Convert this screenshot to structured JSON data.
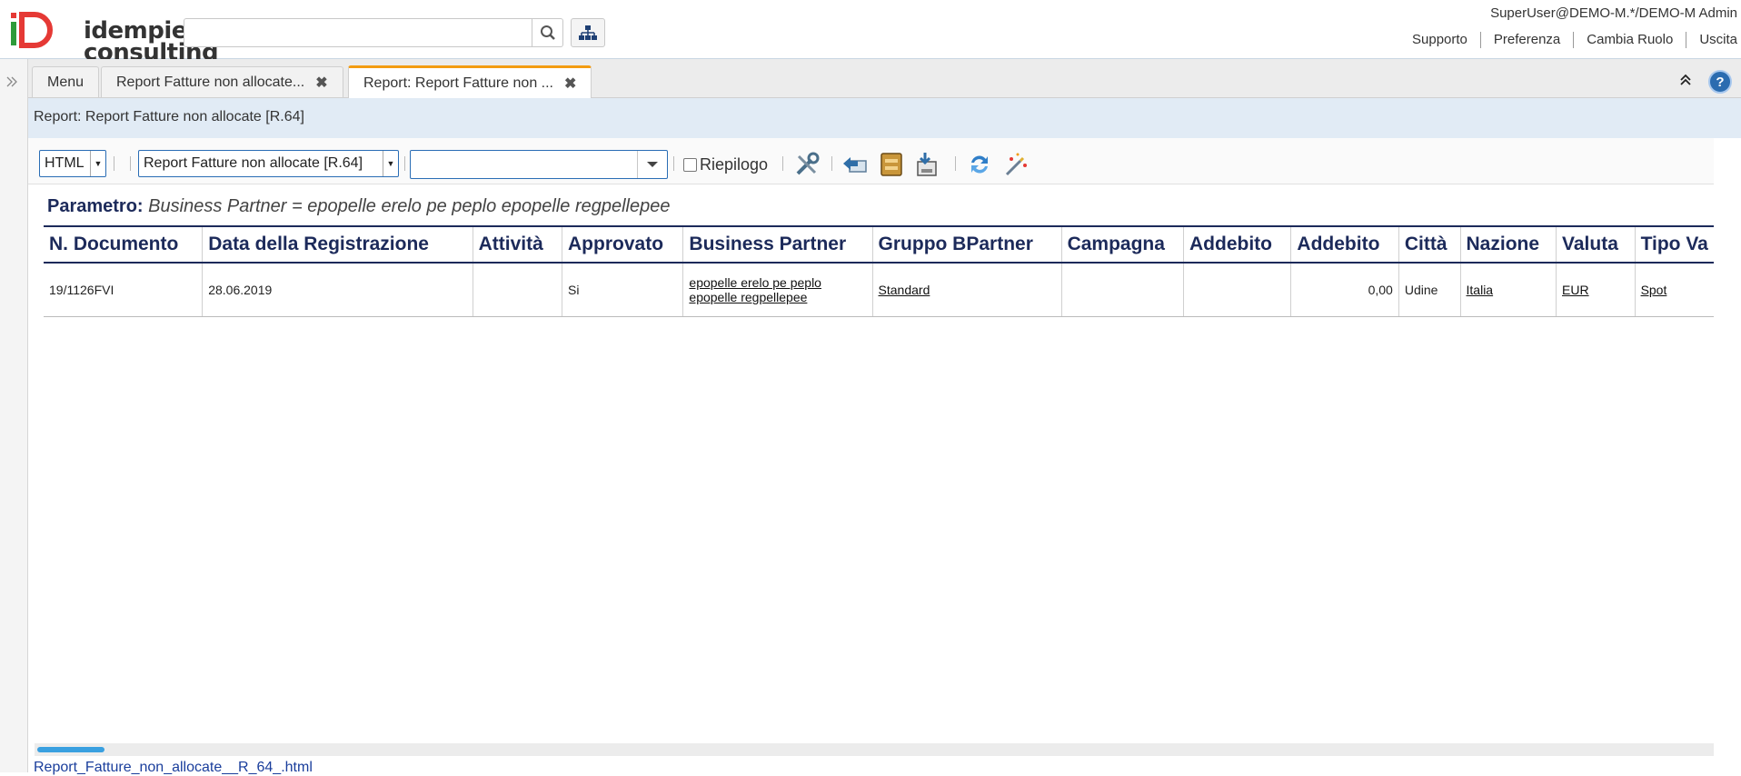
{
  "header": {
    "logo_line1": "idempiere",
    "logo_line2": "consulting",
    "search_value": "",
    "user": "SuperUser@DEMO-M.*/DEMO-M Admin",
    "links": [
      "Supporto",
      "Preferenza",
      "Cambia Ruolo",
      "Uscita"
    ]
  },
  "tabs": [
    {
      "label": "Menu",
      "closable": false
    },
    {
      "label": "Report Fatture non allocate...",
      "closable": true
    },
    {
      "label": "Report: Report Fatture non ...",
      "closable": true,
      "active": true
    }
  ],
  "title": "Report: Report Fatture non allocate [R.64]",
  "toolbar": {
    "format_value": "HTML",
    "report_value": "Report Fatture non allocate [R.64]",
    "print_format_value": "",
    "summary_label": "Riepilogo",
    "summary_checked": false
  },
  "report": {
    "param_label": "Parametro:",
    "param_value": "Business Partner = epopelle erelo pe peplo epopelle regpellepee",
    "columns": [
      "N. Documento",
      "Data della Registrazione",
      "Attività",
      "Approvato",
      "Business Partner",
      "Gruppo BPartner",
      "Campagna",
      "Addebito",
      "Addebito",
      "Città",
      "Nazione",
      "Valuta",
      "Tipo Va"
    ],
    "rows": [
      {
        "doc": "19/1126FVI",
        "date": "28.06.2019",
        "activity": "",
        "approved": "Si",
        "bpartner": "epopelle erelo pe peplo epopelle regpellepee",
        "bp_group": "Standard",
        "campaign": "",
        "debit1": "",
        "debit2": "0,00",
        "city": "Udine",
        "country": "Italia",
        "currency": "EUR",
        "rate_type": "Spot"
      }
    ]
  },
  "footer_link": "Report_Fatture_non_allocate__R_64_.html",
  "colors": {
    "accent": "#f39c12",
    "header_blue": "#1c2a5a",
    "title_bg": "#e1ebf5"
  }
}
